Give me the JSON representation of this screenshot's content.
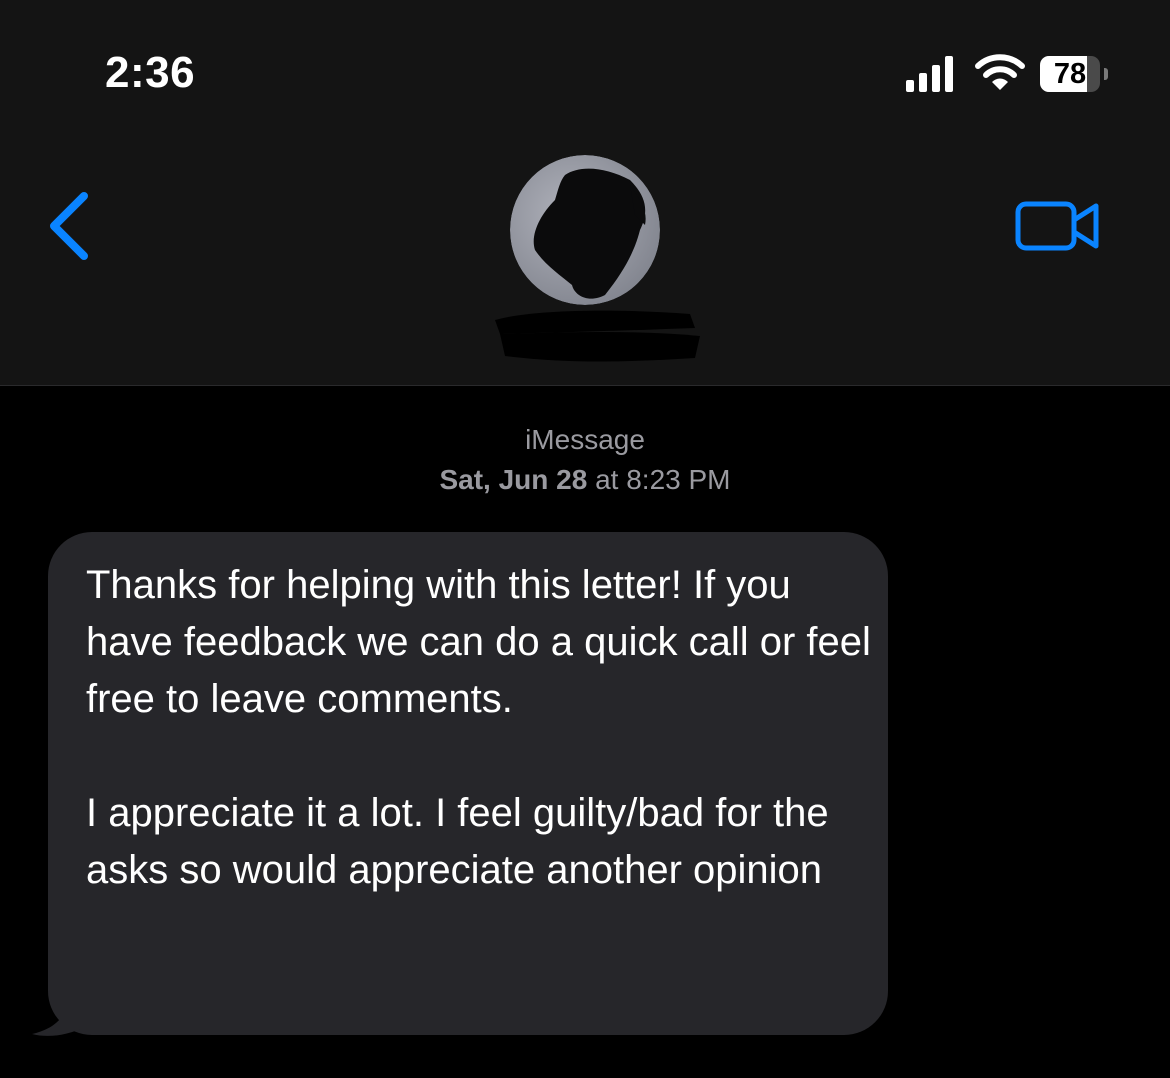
{
  "status_bar": {
    "time": "2:36",
    "battery_level": "78",
    "battery_fraction": 0.78
  },
  "nav": {
    "back_icon": "chevron-left-icon",
    "facetime_icon": "video-camera-icon",
    "accent_color": "#0a84ff"
  },
  "conversation": {
    "service": "iMessage",
    "timestamp_day": "Sat, Jun 28",
    "timestamp_sep": "at",
    "timestamp_time": "8:23 PM"
  },
  "messages": [
    {
      "direction": "incoming",
      "paragraph_1": "Thanks for helping with this letter! If you have feedback we can do a quick call or feel free to leave comments.",
      "paragraph_2": "I appreciate it a lot. I feel guilty/bad for the asks so would appreciate another opinion"
    }
  ],
  "colors": {
    "header_bg": "#141414",
    "bubble_bg": "#26262a",
    "meta_text": "#9a9aa0"
  }
}
